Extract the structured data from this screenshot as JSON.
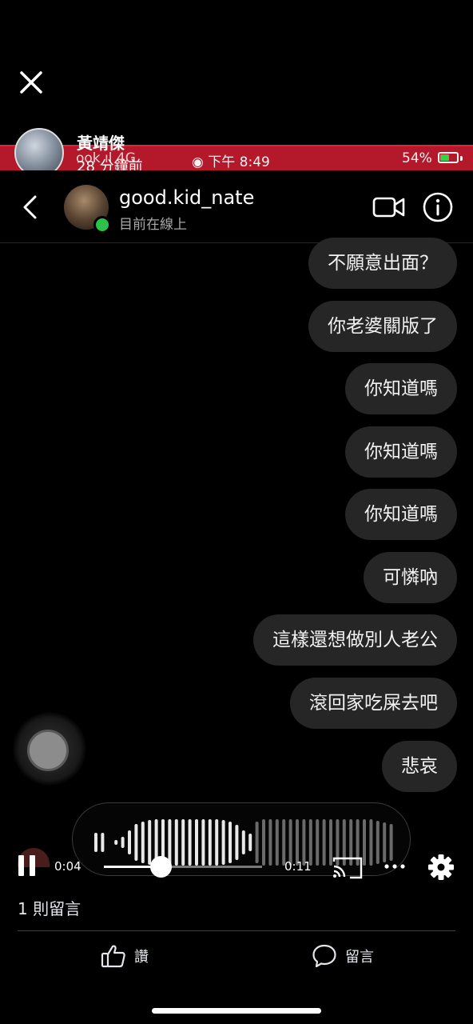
{
  "post": {
    "author": "黃靖傑",
    "time": "28 分鐘前"
  },
  "status_bar": {
    "left": "ook ıl 4G",
    "time": "下午 8:49",
    "battery": "54%",
    "battery_level": 0.54,
    "recording_color": "#b3192b"
  },
  "chat": {
    "username": "good.kid_nate",
    "status": "目前在線上",
    "messages": [
      "不願意出面？",
      "你老婆關版了",
      "你知道嗎",
      "你知道嗎",
      "你知道嗎",
      "可憐吶",
      "這樣還想做別人老公",
      "滾回家吃屎去吧",
      "悲哀"
    ]
  },
  "player": {
    "current_time": "0:04",
    "total_time": "0:11",
    "progress": 0.36
  },
  "footer": {
    "comment_count": "1 則留言",
    "like_label": "讚",
    "comment_label": "留言"
  },
  "colors": {
    "bubble": "#262626",
    "online": "#2cc24a",
    "background": "#000000"
  }
}
